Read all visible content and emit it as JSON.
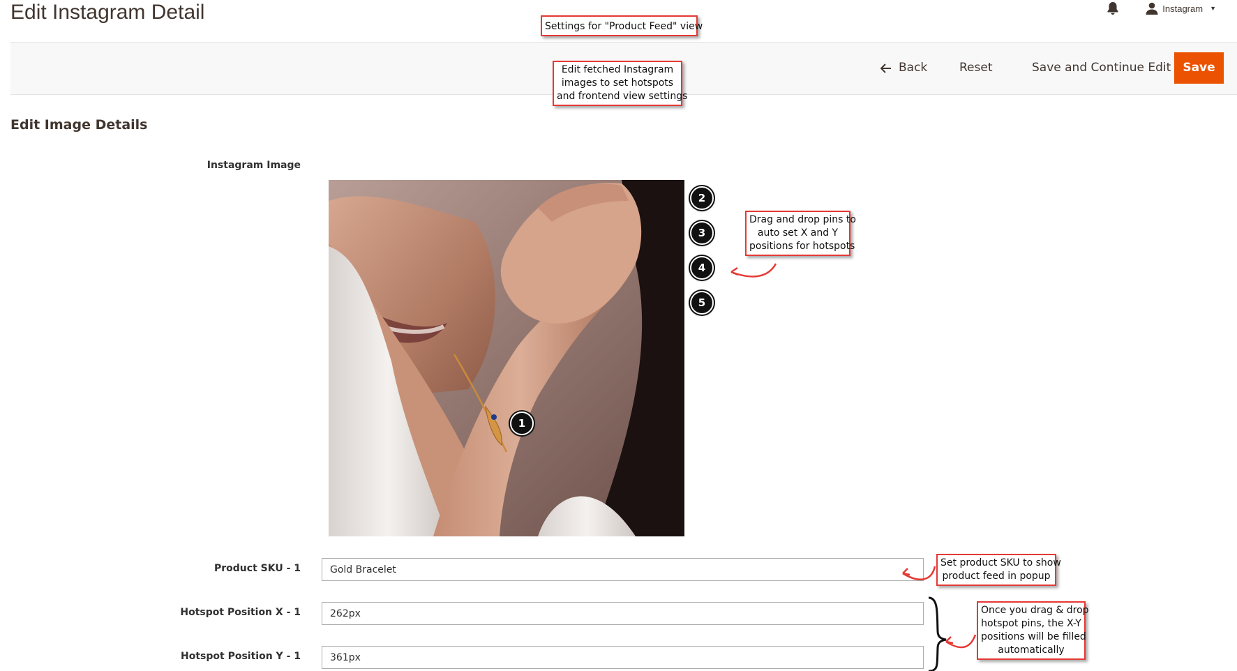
{
  "header": {
    "title": "Edit Instagram Detail",
    "user_name": "Instagram"
  },
  "actions": {
    "back_label": "Back",
    "reset_label": "Reset",
    "save_continue_label": "Save and Continue Edit",
    "save_label": "Save"
  },
  "section": {
    "title": "Edit Image Details"
  },
  "form": {
    "image_label": "Instagram Image",
    "sku_label": "Product SKU - 1",
    "sku_value": "Gold Bracelet",
    "pos_x_label": "Hotspot Position X - 1",
    "pos_x_value": "262px",
    "pos_y_label": "Hotspot Position Y - 1",
    "pos_y_value": "361px"
  },
  "pins": [
    "1",
    "2",
    "3",
    "4",
    "5"
  ],
  "callouts": {
    "product_feed": "Settings for \"Product Feed\" view",
    "edit_images": [
      "Edit fetched Instagram",
      "images to set hotspots",
      "and frontend view settings"
    ],
    "drag_drop": [
      "Drag and drop pins to",
      "auto set X and Y",
      "positions for hotspots"
    ],
    "set_sku": [
      "Set product SKU to show",
      "product feed in popup"
    ],
    "auto_fill": [
      "Once you drag & drop",
      "hotspot pins, the X-Y",
      "positions will be filled",
      "automatically"
    ]
  },
  "colors": {
    "primary_button": "#eb5202",
    "callout_border": "#e53935",
    "title_text": "#41362f"
  }
}
